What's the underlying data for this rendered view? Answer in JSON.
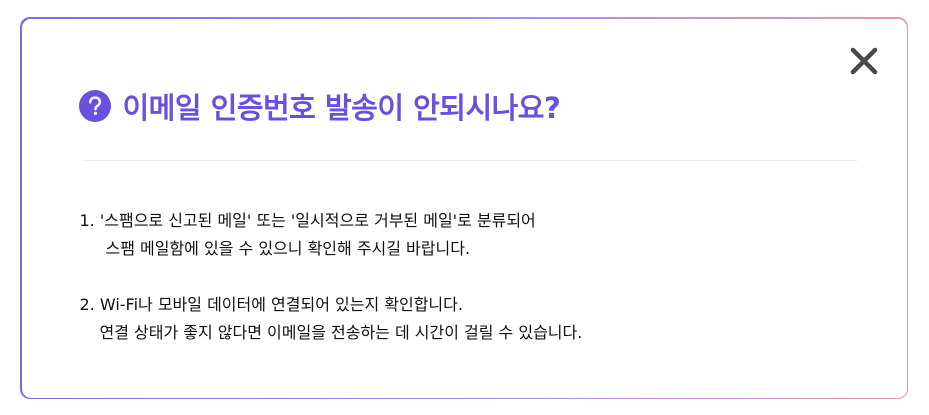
{
  "dialog": {
    "title": "이메일 인증번호 발송이 안되시나요?",
    "accent_color": "#6a4fe0",
    "icons": {
      "title_icon": "question-mark-circle-icon",
      "close_icon": "close-x-icon"
    },
    "items": [
      {
        "line1": "1. '스팸으로 신고된 메일' 또는 '일시적으로 거부된 메일'로 분류되어",
        "line2": "스팸 메일함에 있을 수 있으니 확인해 주시길 바랍니다."
      },
      {
        "line1": "2. Wi-Fi나 모바일 데이터에 연결되어 있는지 확인합니다.",
        "line2": "연결 상태가 좋지 않다면 이메일을 전송하는 데 시간이 걸릴 수 있습니다."
      }
    ]
  }
}
